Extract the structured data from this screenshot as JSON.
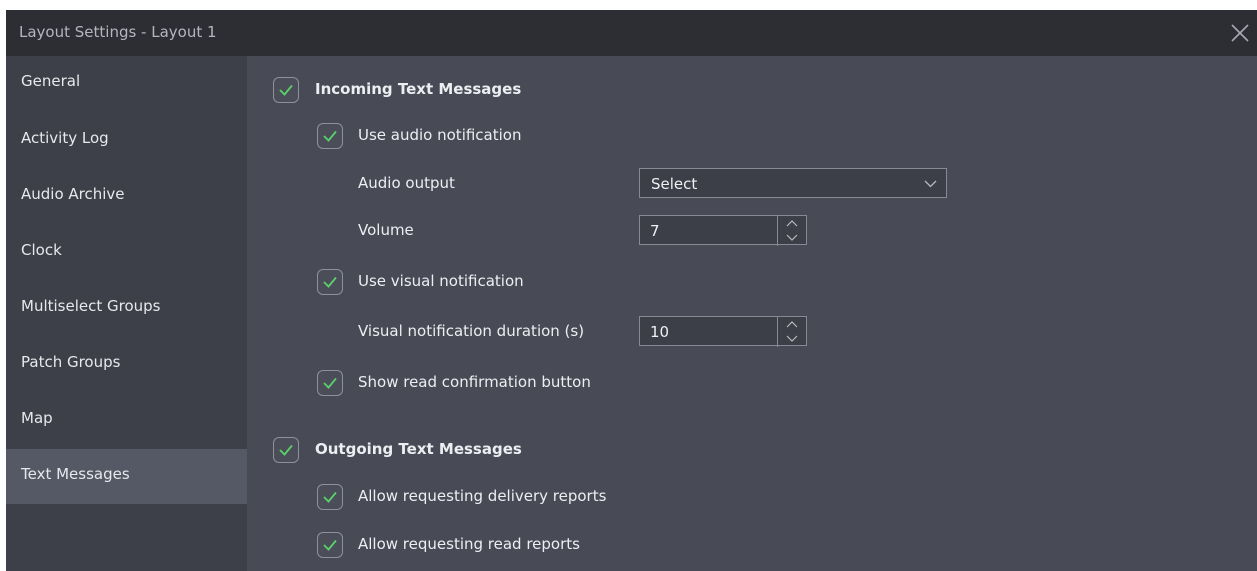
{
  "window": {
    "title": "Layout Settings - Layout 1",
    "close_icon": "close-icon"
  },
  "sidebar": {
    "active": "Text Messages",
    "items": [
      {
        "label": "General"
      },
      {
        "label": "Activity Log"
      },
      {
        "label": "Audio Archive"
      },
      {
        "label": "Clock"
      },
      {
        "label": "Multiselect Groups"
      },
      {
        "label": "Patch Groups"
      },
      {
        "label": "Map"
      },
      {
        "label": "Text Messages"
      }
    ]
  },
  "incoming": {
    "label": "Incoming Text Messages",
    "checked": true,
    "audio_notification": {
      "label": "Use audio notification",
      "checked": true
    },
    "audio_output": {
      "label": "Audio output",
      "value": "Select",
      "icon": "chevron-down-icon"
    },
    "volume": {
      "label": "Volume",
      "value": "7"
    },
    "visual_notification": {
      "label": "Use visual notification",
      "checked": true
    },
    "visual_duration": {
      "label": "Visual notification duration (s)",
      "value": "10"
    },
    "read_confirmation": {
      "label": "Show read confirmation button",
      "checked": true
    }
  },
  "outgoing": {
    "label": "Outgoing Text Messages",
    "checked": true,
    "delivery_reports": {
      "label": "Allow requesting delivery reports",
      "checked": true
    },
    "read_reports": {
      "label": "Allow requesting read reports",
      "checked": true
    }
  },
  "colors": {
    "titlebar_bg": "#2d2e33",
    "sidebar_bg": "#3e4049",
    "sidebar_active_bg": "#555865",
    "content_bg": "#484a55",
    "checkmark": "#5bd16b",
    "text": "#eceef2"
  }
}
